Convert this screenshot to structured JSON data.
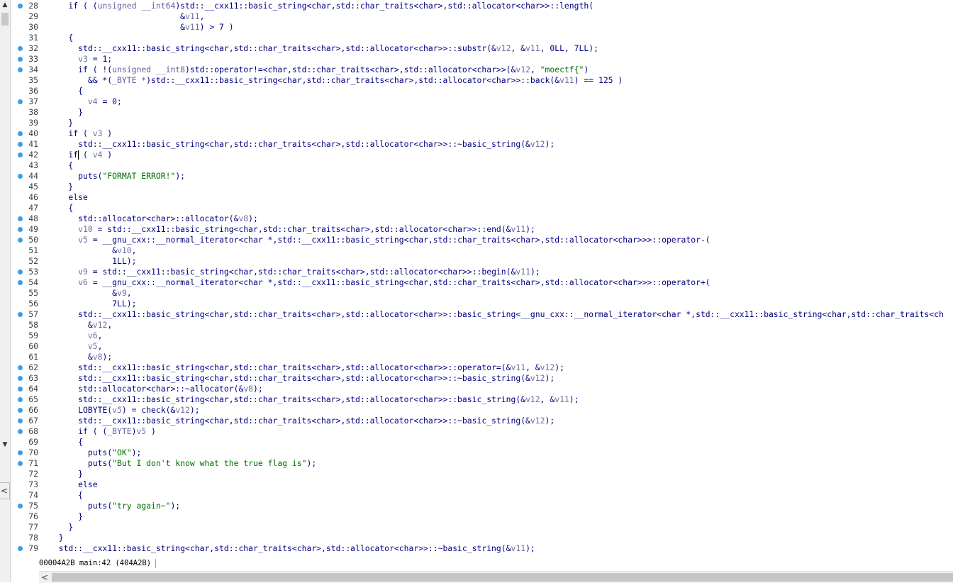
{
  "lines": [
    {
      "n": "28",
      "bp": true,
      "segs": [
        [
          "    if ( (",
          "k"
        ],
        [
          "unsigned __int64",
          "t"
        ],
        [
          ")std::__cxx11::basic_string<char,std::char_traits<char>,std::allocator<char>>::length(",
          "k"
        ]
      ]
    },
    {
      "n": "29",
      "bp": false,
      "segs": [
        [
          "                           &",
          "k"
        ],
        [
          "v11",
          "v"
        ],
        [
          ",",
          "k"
        ]
      ]
    },
    {
      "n": "30",
      "bp": false,
      "segs": [
        [
          "                           &",
          "k"
        ],
        [
          "v11",
          "v"
        ],
        [
          ") > 7 )",
          "k"
        ]
      ]
    },
    {
      "n": "31",
      "bp": false,
      "segs": [
        [
          "    {",
          "k"
        ]
      ]
    },
    {
      "n": "32",
      "bp": true,
      "segs": [
        [
          "      std::__cxx11::basic_string<char,std::char_traits<char>,std::allocator<char>>::substr(&",
          "k"
        ],
        [
          "v12",
          "v"
        ],
        [
          ", &",
          "k"
        ],
        [
          "v11",
          "v"
        ],
        [
          ", 0LL, 7LL);",
          "k"
        ]
      ]
    },
    {
      "n": "33",
      "bp": true,
      "segs": [
        [
          "      ",
          "k"
        ],
        [
          "v3",
          "v"
        ],
        [
          " = 1;",
          "k"
        ]
      ]
    },
    {
      "n": "34",
      "bp": true,
      "segs": [
        [
          "      if ( !(",
          "k"
        ],
        [
          "unsigned __int8",
          "t"
        ],
        [
          ")std::operator!=<char,std::char_traits<char>,std::allocator<char>>(&",
          "k"
        ],
        [
          "v12",
          "v"
        ],
        [
          ", ",
          "k"
        ],
        [
          "\"moectf{\"",
          "s"
        ],
        [
          ")",
          "k"
        ]
      ]
    },
    {
      "n": "35",
      "bp": false,
      "segs": [
        [
          "        && *(",
          "k"
        ],
        [
          "_BYTE *",
          "t"
        ],
        [
          ")std::__cxx11::basic_string<char,std::char_traits<char>,std::allocator<char>>::back(&",
          "k"
        ],
        [
          "v11",
          "v"
        ],
        [
          ") == 125 )",
          "k"
        ]
      ]
    },
    {
      "n": "36",
      "bp": false,
      "segs": [
        [
          "      {",
          "k"
        ]
      ]
    },
    {
      "n": "37",
      "bp": true,
      "segs": [
        [
          "        ",
          "k"
        ],
        [
          "v4",
          "v"
        ],
        [
          " = 0;",
          "k"
        ]
      ]
    },
    {
      "n": "38",
      "bp": false,
      "segs": [
        [
          "      }",
          "k"
        ]
      ]
    },
    {
      "n": "39",
      "bp": false,
      "segs": [
        [
          "    }",
          "k"
        ]
      ]
    },
    {
      "n": "40",
      "bp": true,
      "segs": [
        [
          "    if ( ",
          "k"
        ],
        [
          "v3",
          "v"
        ],
        [
          " )",
          "k"
        ]
      ]
    },
    {
      "n": "41",
      "bp": true,
      "segs": [
        [
          "      std::__cxx11::basic_string<char,std::char_traits<char>,std::allocator<char>>::~basic_string(&",
          "k"
        ],
        [
          "v12",
          "v"
        ],
        [
          ");",
          "k"
        ]
      ]
    },
    {
      "n": "42",
      "bp": true,
      "segs": [
        [
          "    if ( ",
          "k"
        ],
        [
          "v4",
          "v"
        ],
        [
          " )",
          "k"
        ]
      ]
    },
    {
      "n": "43",
      "bp": false,
      "segs": [
        [
          "    {",
          "k"
        ]
      ]
    },
    {
      "n": "44",
      "bp": true,
      "segs": [
        [
          "      puts(",
          "k"
        ],
        [
          "\"FORMAT ERROR!\"",
          "s"
        ],
        [
          ");",
          "k"
        ]
      ]
    },
    {
      "n": "45",
      "bp": false,
      "segs": [
        [
          "    }",
          "k"
        ]
      ]
    },
    {
      "n": "46",
      "bp": false,
      "segs": [
        [
          "    else",
          "k"
        ]
      ]
    },
    {
      "n": "47",
      "bp": false,
      "segs": [
        [
          "    {",
          "k"
        ]
      ]
    },
    {
      "n": "48",
      "bp": true,
      "segs": [
        [
          "      std::allocator<char>::allocator(&",
          "k"
        ],
        [
          "v8",
          "v"
        ],
        [
          ");",
          "k"
        ]
      ]
    },
    {
      "n": "49",
      "bp": true,
      "segs": [
        [
          "      ",
          "k"
        ],
        [
          "v10",
          "v"
        ],
        [
          " = std::__cxx11::basic_string<char,std::char_traits<char>,std::allocator<char>>::end(&",
          "k"
        ],
        [
          "v11",
          "v"
        ],
        [
          ");",
          "k"
        ]
      ]
    },
    {
      "n": "50",
      "bp": true,
      "segs": [
        [
          "      ",
          "k"
        ],
        [
          "v5",
          "v"
        ],
        [
          " = __gnu_cxx::__normal_iterator<char *,std::__cxx11::basic_string<char,std::char_traits<char>,std::allocator<char>>>::operator-(",
          "k"
        ]
      ]
    },
    {
      "n": "51",
      "bp": false,
      "segs": [
        [
          "             &",
          "k"
        ],
        [
          "v10",
          "v"
        ],
        [
          ",",
          "k"
        ]
      ]
    },
    {
      "n": "52",
      "bp": false,
      "segs": [
        [
          "             1LL);",
          "k"
        ]
      ]
    },
    {
      "n": "53",
      "bp": true,
      "segs": [
        [
          "      ",
          "k"
        ],
        [
          "v9",
          "v"
        ],
        [
          " = std::__cxx11::basic_string<char,std::char_traits<char>,std::allocator<char>>::begin(&",
          "k"
        ],
        [
          "v11",
          "v"
        ],
        [
          ");",
          "k"
        ]
      ]
    },
    {
      "n": "54",
      "bp": true,
      "segs": [
        [
          "      ",
          "k"
        ],
        [
          "v6",
          "v"
        ],
        [
          " = __gnu_cxx::__normal_iterator<char *,std::__cxx11::basic_string<char,std::char_traits<char>,std::allocator<char>>>::operator+(",
          "k"
        ]
      ]
    },
    {
      "n": "55",
      "bp": false,
      "segs": [
        [
          "             &",
          "k"
        ],
        [
          "v9",
          "v"
        ],
        [
          ",",
          "k"
        ]
      ]
    },
    {
      "n": "56",
      "bp": false,
      "segs": [
        [
          "             7LL);",
          "k"
        ]
      ]
    },
    {
      "n": "57",
      "bp": true,
      "segs": [
        [
          "      std::__cxx11::basic_string<char,std::char_traits<char>,std::allocator<char>>::basic_string<__gnu_cxx::__normal_iterator<char *,std::__cxx11::basic_string<char,std::char_traits<ch",
          "k"
        ]
      ]
    },
    {
      "n": "58",
      "bp": false,
      "segs": [
        [
          "        &",
          "k"
        ],
        [
          "v12",
          "v"
        ],
        [
          ",",
          "k"
        ]
      ]
    },
    {
      "n": "59",
      "bp": false,
      "segs": [
        [
          "        ",
          "k"
        ],
        [
          "v6",
          "v"
        ],
        [
          ",",
          "k"
        ]
      ]
    },
    {
      "n": "60",
      "bp": false,
      "segs": [
        [
          "        ",
          "k"
        ],
        [
          "v5",
          "v"
        ],
        [
          ",",
          "k"
        ]
      ]
    },
    {
      "n": "61",
      "bp": false,
      "segs": [
        [
          "        &",
          "k"
        ],
        [
          "v8",
          "v"
        ],
        [
          ");",
          "k"
        ]
      ]
    },
    {
      "n": "62",
      "bp": true,
      "segs": [
        [
          "      std::__cxx11::basic_string<char,std::char_traits<char>,std::allocator<char>>::operator=(&",
          "k"
        ],
        [
          "v11",
          "v"
        ],
        [
          ", &",
          "k"
        ],
        [
          "v12",
          "v"
        ],
        [
          ");",
          "k"
        ]
      ]
    },
    {
      "n": "63",
      "bp": true,
      "segs": [
        [
          "      std::__cxx11::basic_string<char,std::char_traits<char>,std::allocator<char>>::~basic_string(&",
          "k"
        ],
        [
          "v12",
          "v"
        ],
        [
          ");",
          "k"
        ]
      ]
    },
    {
      "n": "64",
      "bp": true,
      "segs": [
        [
          "      std::allocator<char>::~allocator(&",
          "k"
        ],
        [
          "v8",
          "v"
        ],
        [
          ");",
          "k"
        ]
      ]
    },
    {
      "n": "65",
      "bp": true,
      "segs": [
        [
          "      std::__cxx11::basic_string<char,std::char_traits<char>,std::allocator<char>>::basic_string(&",
          "k"
        ],
        [
          "v12",
          "v"
        ],
        [
          ", &",
          "k"
        ],
        [
          "v11",
          "v"
        ],
        [
          ");",
          "k"
        ]
      ]
    },
    {
      "n": "66",
      "bp": true,
      "segs": [
        [
          "      LOBYTE(",
          "k"
        ],
        [
          "v5",
          "v"
        ],
        [
          ") = check(&",
          "k"
        ],
        [
          "v12",
          "v"
        ],
        [
          ");",
          "k"
        ]
      ]
    },
    {
      "n": "67",
      "bp": true,
      "segs": [
        [
          "      std::__cxx11::basic_string<char,std::char_traits<char>,std::allocator<char>>::~basic_string(&",
          "k"
        ],
        [
          "v12",
          "v"
        ],
        [
          ");",
          "k"
        ]
      ]
    },
    {
      "n": "68",
      "bp": true,
      "segs": [
        [
          "      if ( (",
          "k"
        ],
        [
          "_BYTE",
          "t"
        ],
        [
          ")",
          "k"
        ],
        [
          "v5",
          "v"
        ],
        [
          " )",
          "k"
        ]
      ]
    },
    {
      "n": "69",
      "bp": false,
      "segs": [
        [
          "      {",
          "k"
        ]
      ]
    },
    {
      "n": "70",
      "bp": true,
      "segs": [
        [
          "        puts(",
          "k"
        ],
        [
          "\"OK\"",
          "s"
        ],
        [
          ");",
          "k"
        ]
      ]
    },
    {
      "n": "71",
      "bp": true,
      "segs": [
        [
          "        puts(",
          "k"
        ],
        [
          "\"But I don't know what the true flag is\"",
          "s"
        ],
        [
          ");",
          "k"
        ]
      ]
    },
    {
      "n": "72",
      "bp": false,
      "segs": [
        [
          "      }",
          "k"
        ]
      ]
    },
    {
      "n": "73",
      "bp": false,
      "segs": [
        [
          "      else",
          "k"
        ]
      ]
    },
    {
      "n": "74",
      "bp": false,
      "segs": [
        [
          "      {",
          "k"
        ]
      ]
    },
    {
      "n": "75",
      "bp": true,
      "segs": [
        [
          "        puts(",
          "k"
        ],
        [
          "\"try again~\"",
          "s"
        ],
        [
          ");",
          "k"
        ]
      ]
    },
    {
      "n": "76",
      "bp": false,
      "segs": [
        [
          "      }",
          "k"
        ]
      ]
    },
    {
      "n": "77",
      "bp": false,
      "segs": [
        [
          "    }",
          "k"
        ]
      ]
    },
    {
      "n": "78",
      "bp": false,
      "segs": [
        [
          "  }",
          "k"
        ]
      ]
    },
    {
      "n": "79",
      "bp": true,
      "segs": [
        [
          "  std::__cxx11::basic_string<char,std::char_traits<char>,std::allocator<char>>::~basic_string(&",
          "k"
        ],
        [
          "v11",
          "v"
        ],
        [
          ");",
          "k"
        ]
      ]
    }
  ],
  "status": {
    "address": "00004A2B",
    "location": "main:42 (404A2B)"
  },
  "icons": {
    "scroll_up": "▲",
    "scroll_down": "▼",
    "scroll_left": "<",
    "collapse": "<"
  }
}
